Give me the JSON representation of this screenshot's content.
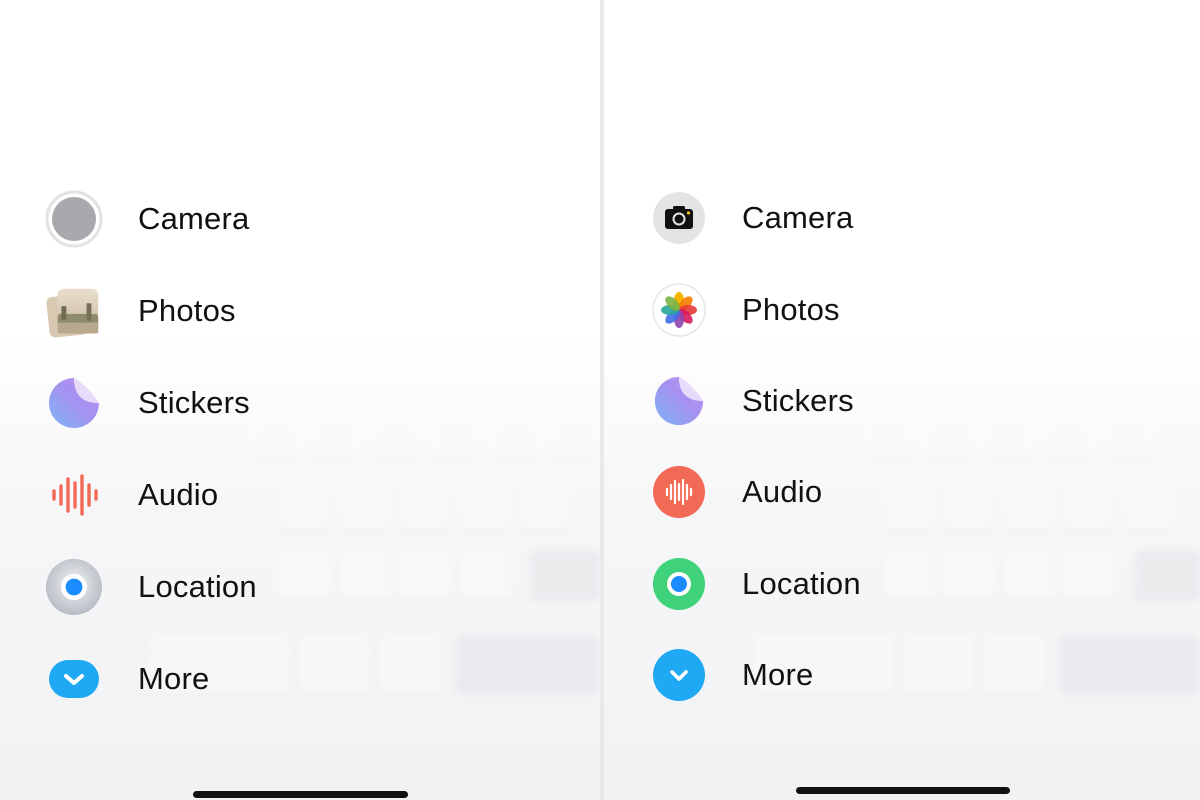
{
  "left_panel": {
    "items": [
      {
        "label": "Camera",
        "icon": "camera-shutter-grey-icon"
      },
      {
        "label": "Photos",
        "icon": "photos-stack-icon"
      },
      {
        "label": "Stickers",
        "icon": "sticker-peel-icon"
      },
      {
        "label": "Audio",
        "icon": "waveform-icon"
      },
      {
        "label": "Location",
        "icon": "location-dot-icon"
      },
      {
        "label": "More",
        "icon": "chevron-down-icon"
      }
    ]
  },
  "right_panel": {
    "items": [
      {
        "label": "Camera",
        "icon": "camera-icon"
      },
      {
        "label": "Photos",
        "icon": "photos-flower-icon"
      },
      {
        "label": "Stickers",
        "icon": "sticker-peel-icon"
      },
      {
        "label": "Audio",
        "icon": "waveform-icon"
      },
      {
        "label": "Location",
        "icon": "location-dot-icon"
      },
      {
        "label": "More",
        "icon": "chevron-down-icon"
      }
    ]
  },
  "colors": {
    "more_blue": "#1fa9f4",
    "audio_red": "#f26a55",
    "location_green": "#3fd27a",
    "location_blue": "#1a8cff",
    "sticker_purple": "#a98bf0"
  }
}
